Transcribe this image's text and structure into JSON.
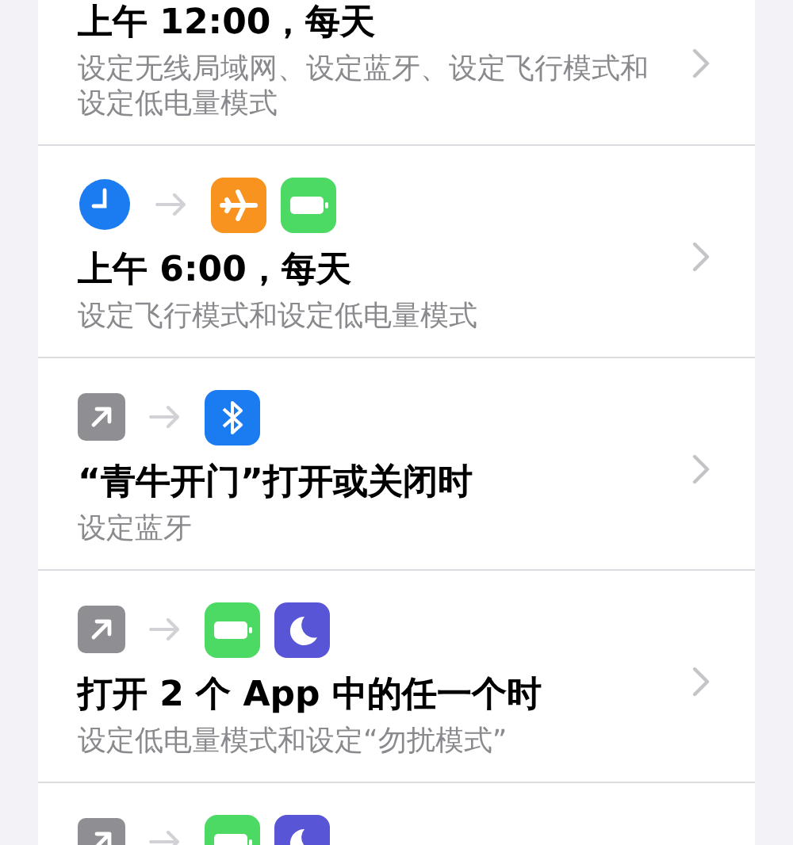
{
  "automations": [
    {
      "title": "上午 12:00，每天",
      "subtitle": "设定无线局域网、设定蓝牙、设定飞行模式和设定低电量模式"
    },
    {
      "icons": [
        {
          "kind": "clock"
        },
        {
          "kind": "airplane"
        },
        {
          "kind": "battery"
        }
      ],
      "title": "上午 6:00，每天",
      "subtitle": "设定飞行模式和设定低电量模式"
    },
    {
      "icons": [
        {
          "kind": "open-app"
        },
        {
          "kind": "bluetooth"
        }
      ],
      "title": "“青牛开门”打开或关闭时",
      "subtitle": "设定蓝牙"
    },
    {
      "icons": [
        {
          "kind": "open-app"
        },
        {
          "kind": "battery"
        },
        {
          "kind": "moon"
        }
      ],
      "title": "打开 2 个 App 中的任一个时",
      "subtitle": "设定低电量模式和设定“勿扰模式”"
    },
    {
      "icons": [
        {
          "kind": "open-app"
        },
        {
          "kind": "battery"
        },
        {
          "kind": "moon"
        }
      ]
    }
  ]
}
